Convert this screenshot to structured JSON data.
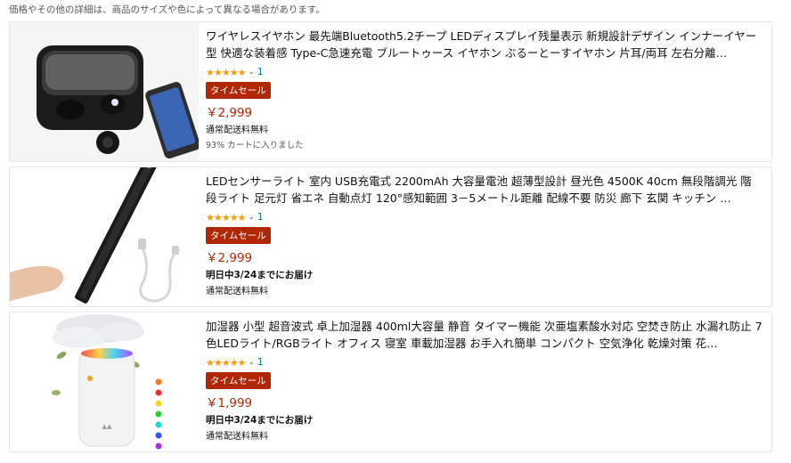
{
  "disclaimer": "価格やその他の詳細は、商品のサイズや色によって異なる場合があります。",
  "colors": {
    "price": "#b12704",
    "sale_badge": "#b12704",
    "star": "#ff9900",
    "link": "#007185"
  },
  "products": [
    {
      "title": "ワイヤレスイヤホン 最先端Bluetooth5.2チープ LEDディスプレイ残量表示 新規設計デザイン インナーイヤー型 快適な装着感 Type-C急速充電 ブルートゥース イヤホン ぶるーとーすイヤホン 片耳/両耳 左右分離…",
      "stars": "★★★★★",
      "rating_count": "1",
      "badge": "タイムセール",
      "price": "￥2,999",
      "delivery_date": "",
      "shipping": "通常配送料無料",
      "cart_note": "93% カートに入りました",
      "image_icon": "earbuds-image"
    },
    {
      "title": "LEDセンサーライト 室内 USB充電式 2200mAh 大容量電池 超薄型設計 昼光色 4500K 40cm 無段階調光 階段ライト 足元灯 省エネ 自動点灯 120°感知範囲 3－5メートル距離 配線不要 防災 廊下 玄関 キッチン …",
      "stars": "★★★★★",
      "rating_count": "1",
      "badge": "タイムセール",
      "price": "￥2,999",
      "delivery_date": "明日中3/24までにお届け",
      "shipping": "通常配送料無料",
      "cart_note": "",
      "image_icon": "led-light-bar-image"
    },
    {
      "title": "加湿器 小型 超音波式 卓上加湿器 400ml大容量 静音 タイマー機能 次亜塩素酸水対応 空焚き防止 水漏れ防止 7色LEDライト/RGBライト オフィス 寝室 車載加湿器 お手入れ簡単 コンパクト 空気浄化 乾燥対策 花…",
      "stars": "★★★★★",
      "rating_count": "1",
      "badge": "タイムセール",
      "price": "￥1,999",
      "delivery_date": "明日中3/24までにお届け",
      "shipping": "通常配送料無料",
      "cart_note": "",
      "image_icon": "humidifier-image"
    }
  ]
}
